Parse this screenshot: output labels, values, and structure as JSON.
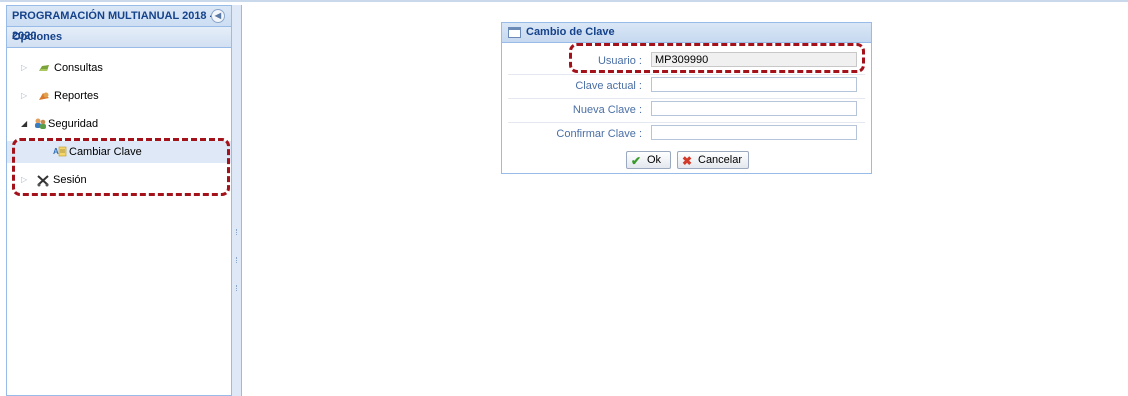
{
  "app": {
    "title": "PROGRAMACIÓN MULTIANUAL 2018 - 2020"
  },
  "sidebar": {
    "header": "Opciones",
    "items": [
      {
        "label": "Consultas",
        "icon": "folder-green-icon"
      },
      {
        "label": "Reportes",
        "icon": "report-icon"
      },
      {
        "label": "Seguridad",
        "icon": "security-users-icon"
      },
      {
        "label": "Cambiar Clave",
        "icon": "change-password-icon"
      },
      {
        "label": "Sesión",
        "icon": "scissors-tools-icon"
      }
    ]
  },
  "dialog": {
    "title": "Cambio de Clave",
    "fields": {
      "usuario": {
        "label": "Usuario :",
        "value": "MP309990"
      },
      "clave_actual": {
        "label": "Clave actual :",
        "value": ""
      },
      "nueva_clave": {
        "label": "Nueva Clave :",
        "value": ""
      },
      "confirmar_clave": {
        "label": "Confirmar Clave :",
        "value": ""
      }
    },
    "buttons": {
      "ok": "Ok",
      "cancel": "Cancelar"
    }
  },
  "colors": {
    "accent": "#15428b",
    "highlight": "#a3111a",
    "panel_border": "#99bbe8"
  }
}
